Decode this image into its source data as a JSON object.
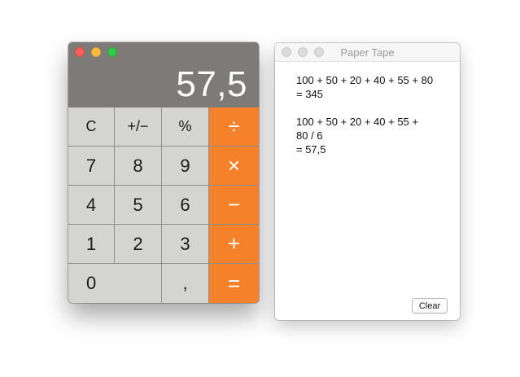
{
  "calculator": {
    "display": "57,5",
    "keys": {
      "clear": "C",
      "sign": "+/−",
      "percent": "%",
      "divide": "÷",
      "seven": "7",
      "eight": "8",
      "nine": "9",
      "multiply": "×",
      "four": "4",
      "five": "5",
      "six": "6",
      "minus": "−",
      "one": "1",
      "two": "2",
      "three": "3",
      "plus": "+",
      "zero": "0",
      "decimal": ",",
      "equals": "="
    },
    "colors": {
      "operator": "#f5822a",
      "key": "#d4d4d2",
      "display_bg": "#7d7a77"
    }
  },
  "tape": {
    "title": "Paper Tape",
    "entries": [
      {
        "lines": [
          "100 + 50 + 20 + 40 + 55 + 80",
          "= 345"
        ]
      },
      {
        "lines": [
          "100 + 50 + 20 + 40 + 55 +",
          "80 / 6",
          "= 57,5"
        ]
      }
    ],
    "clear_label": "Clear"
  }
}
